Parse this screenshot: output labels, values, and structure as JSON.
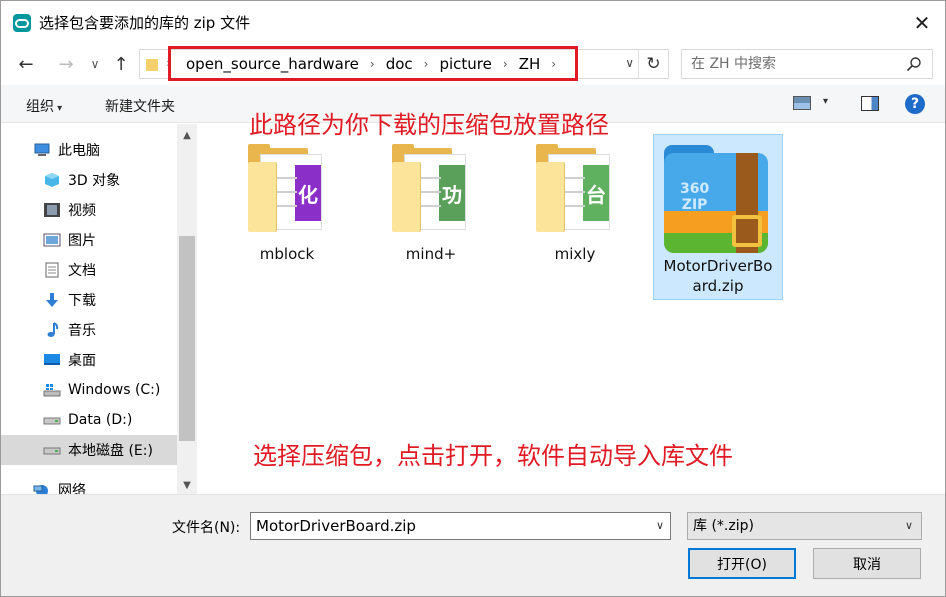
{
  "window": {
    "title": "选择包含要添加的库的 zip 文件",
    "close_glyph": "✕"
  },
  "nav": {
    "back_glyph": "←",
    "forward_glyph": "→",
    "recent_glyph": "∨",
    "up_glyph": "↑",
    "breadcrumbs": [
      "open_source_hardware",
      "doc",
      "picture",
      "ZH"
    ],
    "crumb_sep": "›",
    "refresh_glyph": "↻",
    "dropdown_glyph": "∨"
  },
  "search": {
    "placeholder": "在 ZH 中搜索"
  },
  "toolbar": {
    "organize_label": "组织",
    "new_folder_label": "新建文件夹",
    "help_glyph": "?"
  },
  "sidebar": {
    "items": [
      {
        "label": "此电脑",
        "icon": "computer-icon"
      },
      {
        "label": "3D 对象",
        "icon": "3d-objects-icon"
      },
      {
        "label": "视频",
        "icon": "video-icon"
      },
      {
        "label": "图片",
        "icon": "pictures-icon"
      },
      {
        "label": "文档",
        "icon": "documents-icon"
      },
      {
        "label": "下载",
        "icon": "download-icon"
      },
      {
        "label": "音乐",
        "icon": "music-icon"
      },
      {
        "label": "桌面",
        "icon": "desktop-icon"
      },
      {
        "label": "Windows (C:)",
        "icon": "windows-drive-icon"
      },
      {
        "label": "Data (D:)",
        "icon": "drive-icon"
      },
      {
        "label": "本地磁盘 (E:)",
        "icon": "drive-icon",
        "selected": true
      },
      {
        "label": "网络",
        "icon": "network-icon"
      }
    ]
  },
  "files": [
    {
      "name": "mblock",
      "type": "folder",
      "band_color": "#8b2fc9",
      "band_text": "化"
    },
    {
      "name": "mind+",
      "type": "folder",
      "band_color": "#5aa05a",
      "band_text": "功"
    },
    {
      "name": "mixly",
      "type": "folder",
      "band_color": "#5fb05f",
      "band_text": "台"
    },
    {
      "name_line1": "MotorDriverBo",
      "name_line2": "ard.zip",
      "type": "zip",
      "selected": true,
      "icon_text_1": "360",
      "icon_text_2": "ZIP"
    }
  ],
  "annotations": {
    "top": "此路径为你下载的压缩包放置路径",
    "bottom": "选择压缩包，点击打开，软件自动导入库文件"
  },
  "footer": {
    "filename_label": "文件名(N):",
    "filename_value": "MotorDriverBoard.zip",
    "filetype_value": "库 (*.zip)",
    "open_label": "打开(O)",
    "cancel_label": "取消"
  },
  "colors": {
    "annotation_red": "#e01b24",
    "selection_blue": "#cce8ff",
    "accent_blue": "#0078d7"
  }
}
